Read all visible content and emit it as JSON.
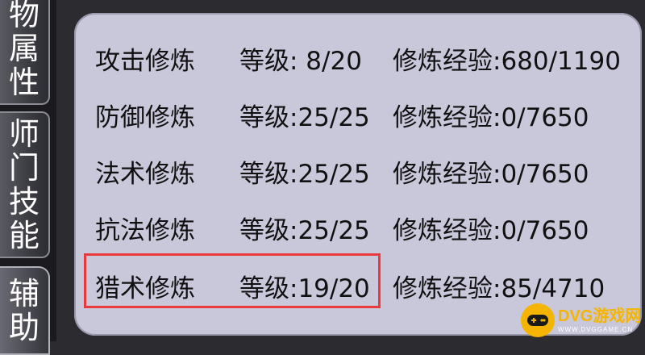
{
  "tabs": [
    {
      "chars": [
        "物",
        "属",
        "性"
      ]
    },
    {
      "chars": [
        "师",
        "门",
        "技",
        "能"
      ]
    },
    {
      "chars": [
        "辅",
        "助"
      ]
    }
  ],
  "rows": [
    {
      "name": "攻击修炼",
      "level": "等级: 8/20",
      "exp": "修炼经验:680/1190"
    },
    {
      "name": "防御修炼",
      "level": "等级:25/25",
      "exp": "修炼经验:0/7650"
    },
    {
      "name": "法术修炼",
      "level": "等级:25/25",
      "exp": "修炼经验:0/7650"
    },
    {
      "name": "抗法修炼",
      "level": "等级:25/25",
      "exp": "修炼经验:0/7650"
    },
    {
      "name": "猎术修炼",
      "level": "等级:19/20",
      "exp": "修炼经验:85/4710"
    }
  ],
  "watermark": {
    "main": "DVG游戏网",
    "sub": "WWW.DVGGAME.CN"
  },
  "colors": {
    "panel": "#c9c7da",
    "highlight": "#e83a3a",
    "logo": "#f4b400"
  }
}
